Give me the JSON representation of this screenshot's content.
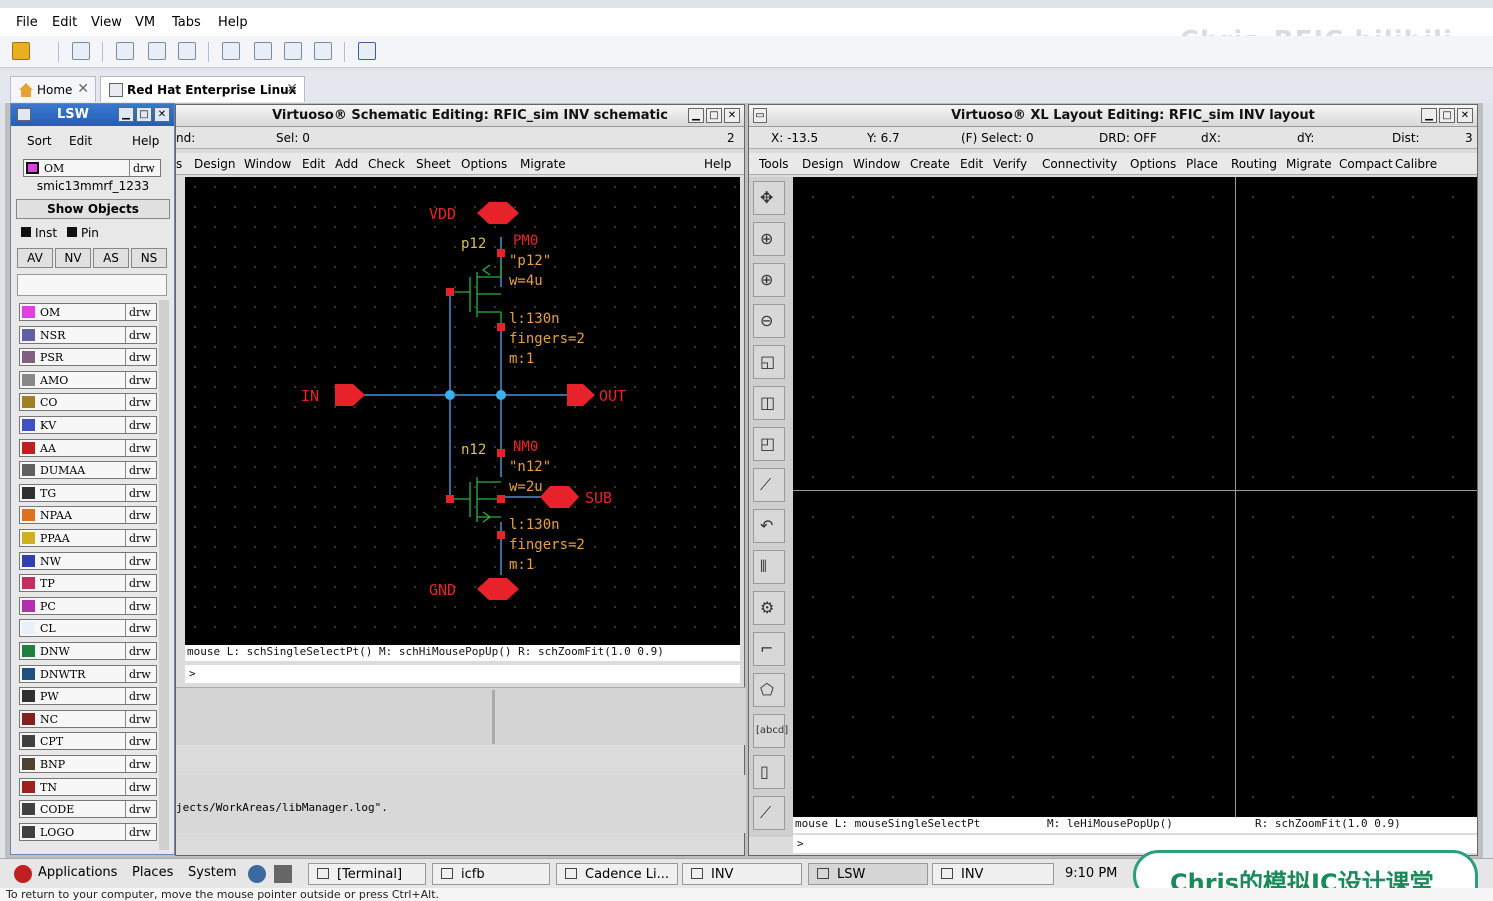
{
  "vm": {
    "menu": [
      "File",
      "Edit",
      "View",
      "VM",
      "Tabs",
      "Help"
    ],
    "watermark": "Chris_RFIC bilibili"
  },
  "tabs": [
    {
      "label": "Home"
    },
    {
      "label": "Red Hat Enterprise Linux ..."
    }
  ],
  "lsw": {
    "title": "LSW",
    "menu": [
      "Sort",
      "Edit",
      "Help"
    ],
    "current_layer": "OM",
    "current_purpose": "drw",
    "tech": "smic13mmrf_1233",
    "show_objects": "Show Objects",
    "inst": "Inst",
    "pin": "Pin",
    "buttons": [
      "AV",
      "NV",
      "AS",
      "NS"
    ],
    "layers": [
      {
        "name": "OM",
        "purpose": "drw",
        "color": "#e040e0"
      },
      {
        "name": "NSR",
        "purpose": "drw",
        "color": "#6060a0"
      },
      {
        "name": "PSR",
        "purpose": "drw",
        "color": "#806080"
      },
      {
        "name": "AMO",
        "purpose": "drw",
        "color": "#888888"
      },
      {
        "name": "CO",
        "purpose": "drw",
        "color": "#a08020"
      },
      {
        "name": "KV",
        "purpose": "drw",
        "color": "#4050c0"
      },
      {
        "name": "AA",
        "purpose": "drw",
        "color": "#c02020"
      },
      {
        "name": "DUMAA",
        "purpose": "drw",
        "color": "#606060"
      },
      {
        "name": "TG",
        "purpose": "drw",
        "color": "#303030"
      },
      {
        "name": "NPAA",
        "purpose": "drw",
        "color": "#e07020"
      },
      {
        "name": "PPAA",
        "purpose": "drw",
        "color": "#d0b020"
      },
      {
        "name": "NW",
        "purpose": "drw",
        "color": "#3040b0"
      },
      {
        "name": "TP",
        "purpose": "drw",
        "color": "#c03060"
      },
      {
        "name": "PC",
        "purpose": "drw",
        "color": "#b030b0"
      },
      {
        "name": "CL",
        "purpose": "drw",
        "color": "#e8f0f8"
      },
      {
        "name": "DNW",
        "purpose": "drw",
        "color": "#208040"
      },
      {
        "name": "DNWTR",
        "purpose": "drw",
        "color": "#205080"
      },
      {
        "name": "PW",
        "purpose": "drw",
        "color": "#303030"
      },
      {
        "name": "NC",
        "purpose": "drw",
        "color": "#802020"
      },
      {
        "name": "CPT",
        "purpose": "drw",
        "color": "#404040"
      },
      {
        "name": "BNP",
        "purpose": "drw",
        "color": "#504030"
      },
      {
        "name": "TN",
        "purpose": "drw",
        "color": "#a02020"
      },
      {
        "name": "CODE",
        "purpose": "drw",
        "color": "#404040"
      },
      {
        "name": "LOGO",
        "purpose": "drw",
        "color": "#404040"
      }
    ]
  },
  "schematic": {
    "title": "Virtuoso® Schematic Editing: RFIC_sim INV schematic",
    "status_left": "nd:",
    "sel": "Sel: 0",
    "count": "2",
    "menu": [
      "s",
      "Design",
      "Window",
      "Edit",
      "Add",
      "Check",
      "Sheet",
      "Options",
      "Migrate",
      "Help"
    ],
    "mouse": "mouse L: schSingleSelectPt() M: schHiMousePopUp()     R: schZoomFit(1.0 0.9)",
    "prompt": ">",
    "log": "jects/WorkAreas/libManager.log\".",
    "pins": {
      "vdd": "VDD",
      "gnd": "GND",
      "in": "IN",
      "out": "OUT",
      "sub": "SUB"
    },
    "pmos": {
      "inst": "PM0",
      "model": "\"p12\"",
      "cell": "p12",
      "w": "w=4u",
      "l": "l:130n",
      "fingers": "fingers=2",
      "m": "m:1"
    },
    "nmos": {
      "inst": "NM0",
      "model": "\"n12\"",
      "cell": "n12",
      "w": "w=2u",
      "l": "l:130n",
      "fingers": "fingers=2",
      "m": "m:1"
    }
  },
  "layout": {
    "title": "Virtuoso® XL Layout Editing: RFIC_sim INV layout",
    "status": {
      "x": "X: -13.5",
      "y": "Y: 6.7",
      "select": "(F) Select: 0",
      "drd": "DRD: OFF",
      "dx": "dX:",
      "dy": "dY:",
      "dist": "Dist:",
      "count": "3"
    },
    "menu": [
      "Tools",
      "Design",
      "Window",
      "Create",
      "Edit",
      "Verify",
      "Connectivity",
      "Options",
      "Place",
      "Routing",
      "Migrate",
      "Compact",
      "Calibre"
    ],
    "mouse_l": "mouse L: mouseSingleSelectPt",
    "mouse_m": "M: leHiMousePopUp()",
    "mouse_r": "R: schZoomFit(1.0 0.9)",
    "prompt": ">",
    "abcd": "[abcd]"
  },
  "taskbar": {
    "applications": "Applications",
    "places": "Places",
    "system": "System",
    "tasks": [
      "[Terminal]",
      "icfb",
      "Cadence Li...",
      "INV",
      "LSW",
      "INV"
    ],
    "time": "9:10 PM",
    "banner": "Chris的模拟IC设计课堂"
  },
  "statusbar": "To return to your computer, move the mouse pointer outside or press Ctrl+Alt."
}
